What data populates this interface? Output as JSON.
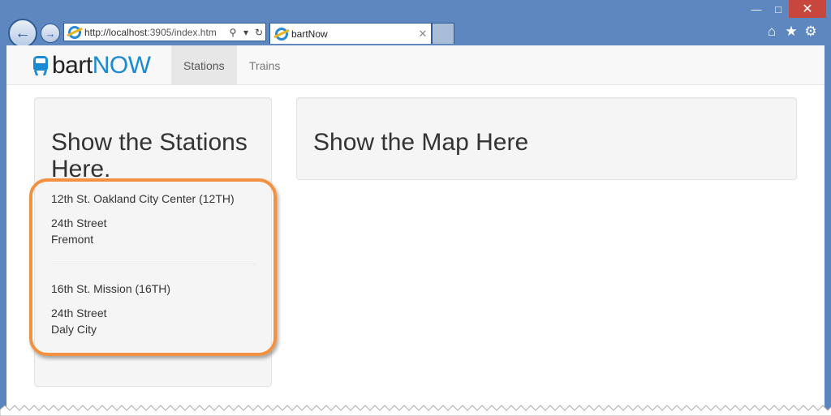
{
  "browser": {
    "address_host": "http://localhost",
    "address_path": ":3905/index.htm",
    "tab_title": "bartNow",
    "window_controls": [
      "minimize-icon",
      "maximize-icon",
      "close-icon"
    ],
    "toolbar_icons": [
      "home-icon",
      "star-icon",
      "gear-icon"
    ]
  },
  "navbar": {
    "brand_prefix": "bart",
    "brand_suffix": "NOW",
    "items": [
      {
        "label": "Stations",
        "active": true
      },
      {
        "label": "Trains",
        "active": false
      }
    ]
  },
  "stations_panel": {
    "title": "Show the Stations Here.",
    "stations": [
      {
        "name": "12th St. Oakland City Center (12TH)",
        "line1": "24th Street",
        "line2": "Fremont"
      },
      {
        "name": "16th St. Mission (16TH)",
        "line1": "24th Street",
        "line2": "Daly City"
      }
    ]
  },
  "map_panel": {
    "title": "Show the Map Here"
  },
  "colors": {
    "brand_accent": "#1a8ad3",
    "highlight": "#f39140",
    "chrome": "#5d87be"
  }
}
